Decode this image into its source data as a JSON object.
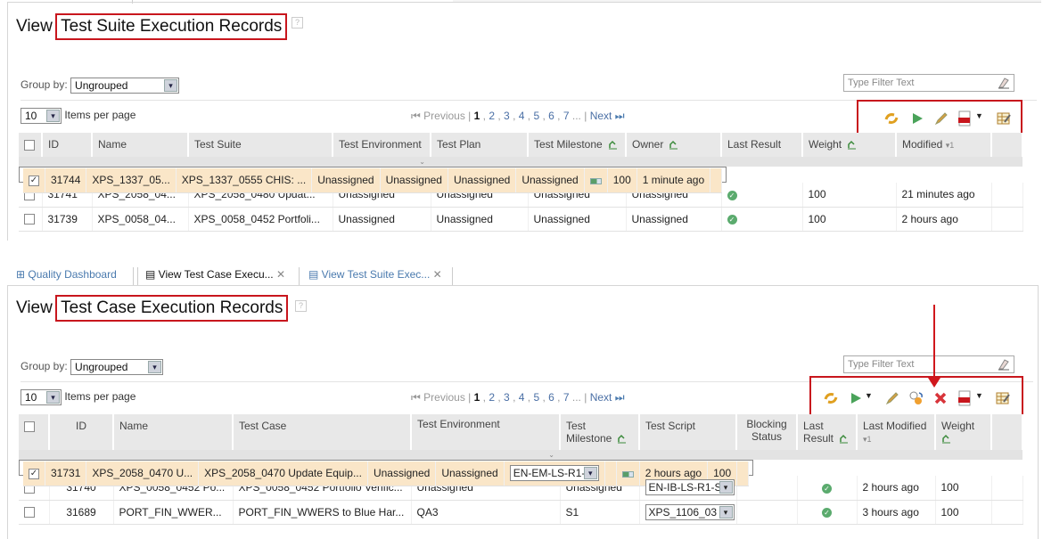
{
  "suite_panel": {
    "title_prefix": "View ",
    "title_highlight": "Test Suite Execution Records",
    "help_icon": "?",
    "group_by_label": "Group by:",
    "group_by_value": "Ungrouped",
    "items_per_page_value": "10",
    "items_per_page_label": "Items per page",
    "pager": {
      "previous": "Previous",
      "current": "1",
      "pages": [
        "2",
        "3",
        "4",
        "5",
        "6",
        "7"
      ],
      "ellipsis": "...",
      "next": "Next"
    },
    "filter_placeholder": "Type Filter Text",
    "toolbar_icons": [
      "refresh-icon",
      "run-icon",
      "edit-icon",
      "pdf-export-icon",
      "table-settings-icon"
    ],
    "columns": [
      "ID",
      "Name",
      "Test Suite",
      "Test Environment",
      "Test Plan",
      "Test Milestone",
      "Owner",
      "Last Result",
      "Weight",
      "Modified"
    ],
    "sort_indicator": "▾1",
    "rows": [
      {
        "checked": true,
        "id": "31744",
        "name": "XPS_1337_05...",
        "suite": "XPS_1337_0555 CHIS: ...",
        "env": "Unassigned",
        "plan": "Unassigned",
        "milestone": "Unassigned",
        "owner": "Unassigned",
        "result": "partial",
        "weight": "100",
        "modified": "1 minute ago"
      },
      {
        "checked": false,
        "id": "31741",
        "name": "XPS_2058_04...",
        "suite": "XPS_2058_0480 Updat...",
        "env": "Unassigned",
        "plan": "Unassigned",
        "milestone": "Unassigned",
        "owner": "Unassigned",
        "result": "passed",
        "weight": "100",
        "modified": "21 minutes ago"
      },
      {
        "checked": false,
        "id": "31739",
        "name": "XPS_0058_04...",
        "suite": "XPS_0058_0452 Portfoli...",
        "env": "Unassigned",
        "plan": "Unassigned",
        "milestone": "Unassigned",
        "owner": "Unassigned",
        "result": "passed",
        "weight": "100",
        "modified": "2 hours ago"
      }
    ]
  },
  "tabs": [
    {
      "label": "Quality Dashboard",
      "active": false
    },
    {
      "label": "View Test Case Execu...",
      "active": true
    },
    {
      "label": "View Test Suite Exec...",
      "active": false
    }
  ],
  "case_panel": {
    "title_prefix": "View ",
    "title_highlight": "Test Case Execution Records",
    "help_icon": "?",
    "group_by_label": "Group by:",
    "group_by_value": "Ungrouped",
    "items_per_page_value": "10",
    "items_per_page_label": "Items per page",
    "pager": {
      "previous": "Previous",
      "current": "1",
      "pages": [
        "2",
        "3",
        "4",
        "5",
        "6",
        "7"
      ],
      "ellipsis": "...",
      "next": "Next"
    },
    "filter_placeholder": "Type Filter Text",
    "toolbar_icons": [
      "refresh-icon",
      "run-icon",
      "edit-icon",
      "reassign-icon",
      "delete-icon",
      "pdf-export-icon",
      "table-settings-icon"
    ],
    "columns": [
      "ID",
      "Name",
      "Test Case",
      "Test Environment",
      "Test Milestone",
      "Test Script",
      "Blocking Status",
      "Last Result",
      "Last Modified",
      "Weight"
    ],
    "sort_indicator": "▾1",
    "rows": [
      {
        "checked": true,
        "id": "31731",
        "name": "XPS_2058_0470 U...",
        "case": "XPS_2058_0470 Update Equip...",
        "env": "Unassigned",
        "milestone": "Unassigned",
        "script": "EN-EM-LS-R1-",
        "blocking": "",
        "result": "partial",
        "modified": "2 hours ago",
        "weight": "100"
      },
      {
        "checked": false,
        "id": "31740",
        "name": "XPS_0058_0452 Po...",
        "case": "XPS_0058_0452 Portfolio Verific...",
        "env": "Unassigned",
        "milestone": "Unassigned",
        "script": "EN-IB-LS-R1-S",
        "blocking": "",
        "result": "passed",
        "modified": "2 hours ago",
        "weight": "100"
      },
      {
        "checked": false,
        "id": "31689",
        "name": "PORT_FIN_WWER...",
        "case": "PORT_FIN_WWERS to Blue Har...",
        "env": "QA3",
        "milestone": "S1",
        "script": "XPS_1106_03",
        "blocking": "",
        "result": "passed",
        "modified": "3 hours ago",
        "weight": "100"
      }
    ]
  },
  "colors": {
    "highlight_border": "#c8161d",
    "selected_row": "#fae6c8",
    "link": "#4a7aae"
  }
}
